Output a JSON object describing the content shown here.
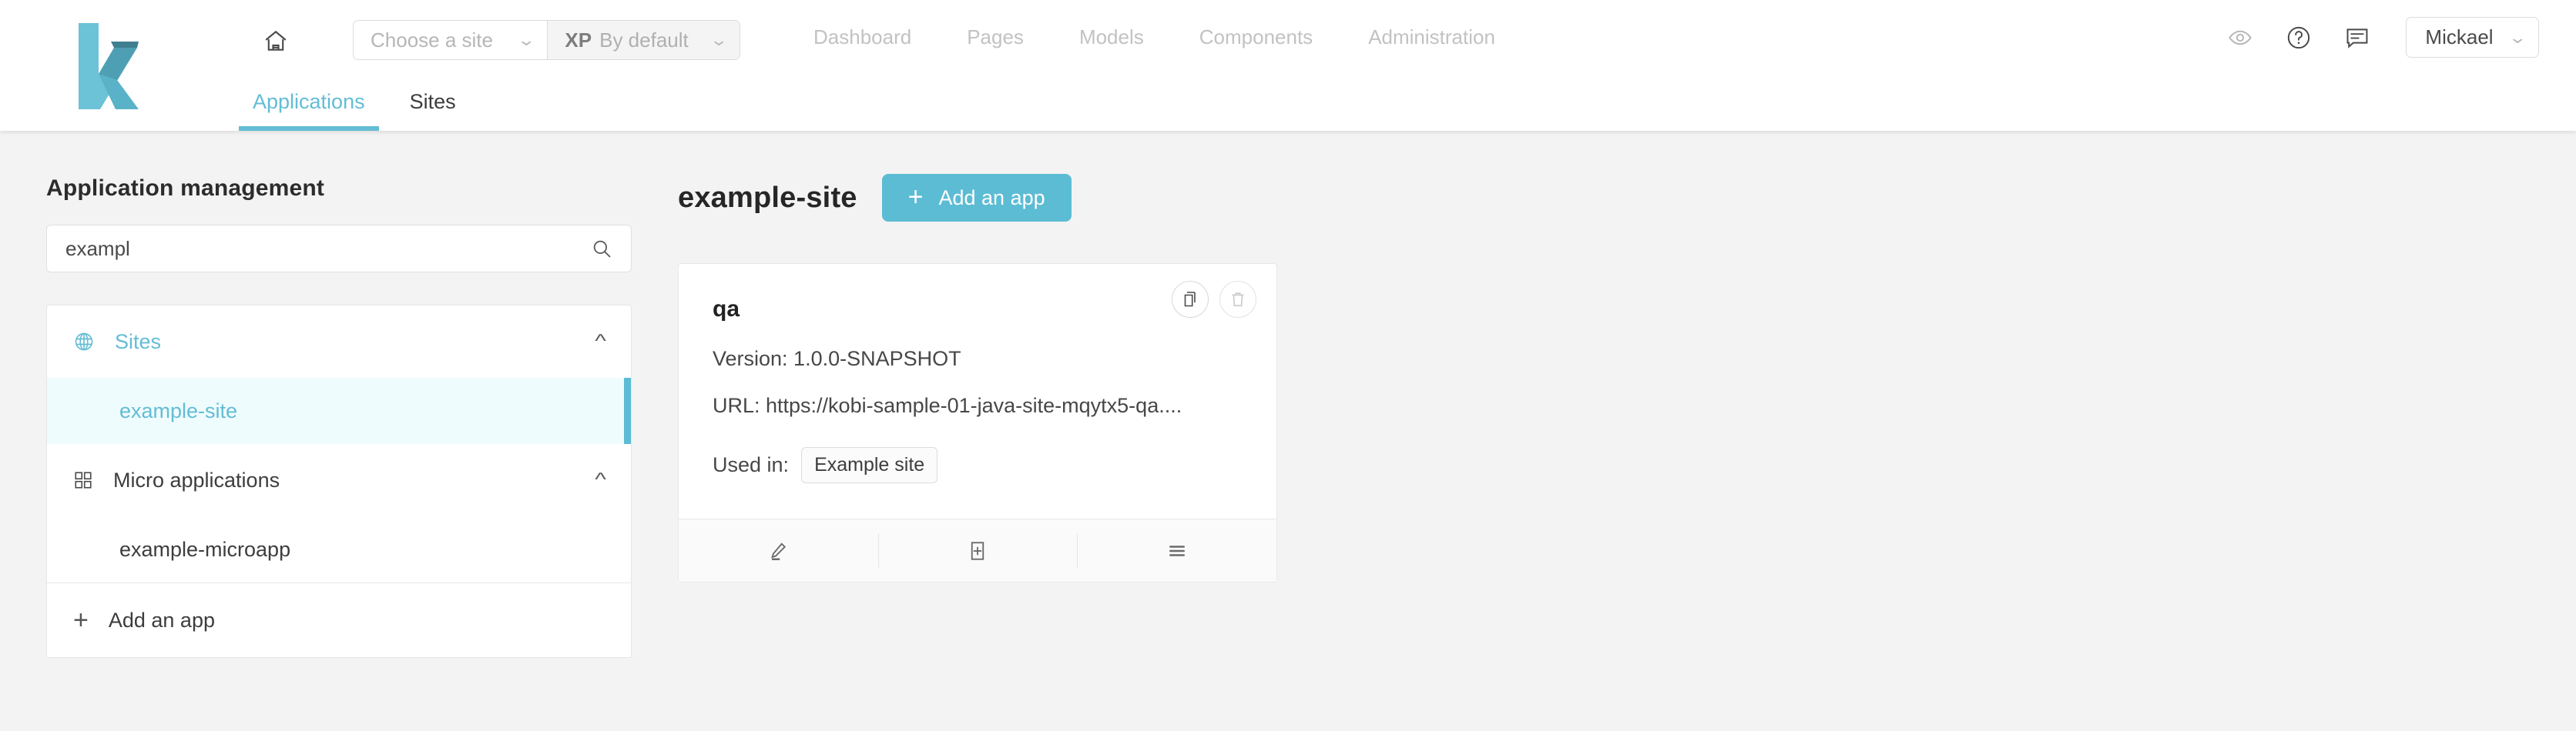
{
  "header": {
    "logo_alt": "kobi-logo",
    "home_label": "Home",
    "site_selector": {
      "placeholder": "Choose a site",
      "value": "Choose a site"
    },
    "xp_selector": {
      "badge": "XP",
      "value": "By default"
    },
    "nav": [
      {
        "label": "Dashboard"
      },
      {
        "label": "Pages"
      },
      {
        "label": "Models"
      },
      {
        "label": "Components"
      },
      {
        "label": "Administration"
      }
    ],
    "user": {
      "name": "Mickael"
    },
    "tabs": [
      {
        "label": "Applications",
        "active": true
      },
      {
        "label": "Sites",
        "active": false
      }
    ]
  },
  "sidebar": {
    "title": "Application management",
    "search": {
      "value": "exampl",
      "placeholder": "Search"
    },
    "groups": [
      {
        "label": "Sites",
        "icon": "globe-icon",
        "expanded": true,
        "items": [
          {
            "label": "example-site",
            "selected": true
          }
        ]
      },
      {
        "label": "Micro applications",
        "icon": "grid-icon",
        "expanded": true,
        "items": [
          {
            "label": "example-microapp",
            "selected": false
          }
        ]
      }
    ],
    "add_app_label": "Add an app"
  },
  "main": {
    "title": "example-site",
    "add_app_button": "Add an app",
    "card": {
      "name": "qa",
      "version_line": "Version: 1.0.0-SNAPSHOT",
      "url_line": "URL: https://kobi-sample-01-java-site-mqytx5-qa....",
      "used_in_label": "Used in:",
      "used_in_value": "Example site",
      "actions": {
        "duplicate": "Duplicate",
        "delete": "Delete"
      },
      "footer": {
        "edit": "Edit",
        "add_page": "Add a page",
        "menu": "More options"
      }
    }
  },
  "colors": {
    "accent": "#5cbcd4",
    "accent_light": "#effcfd",
    "page_bg": "#f3f3f3",
    "text": "#3d3d3d"
  }
}
